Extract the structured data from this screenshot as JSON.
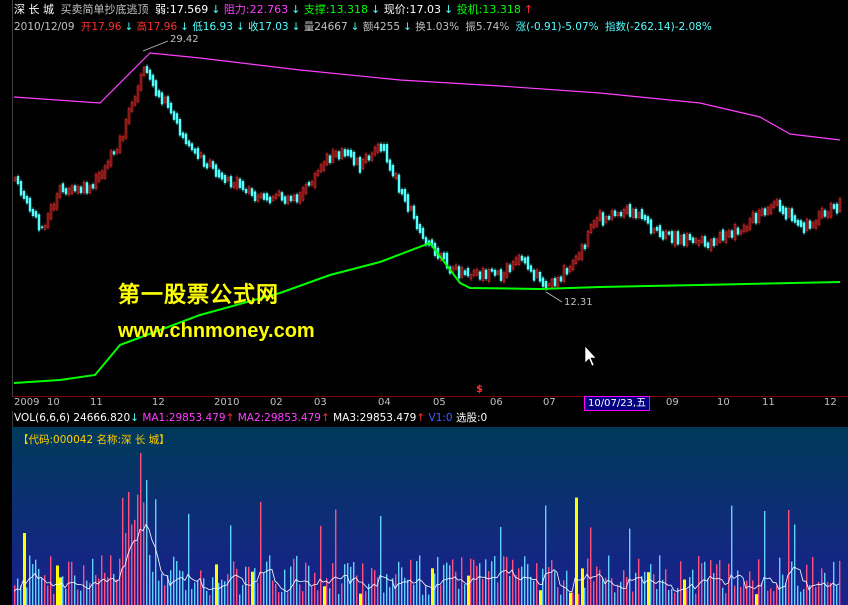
{
  "header": {
    "stock": "深 长 城",
    "formula": "买卖简单抄底逃顶",
    "weak": "弱:17.569",
    "resist": "阻力:22.763",
    "support": "支撑:13.318",
    "price": "现价:17.03",
    "invest": "投机:13.318"
  },
  "quote": {
    "date": "2010/12/09",
    "open": "开17.96",
    "high": "高17.96",
    "low": "低16.93",
    "close": "收17.03",
    "vol": "量24667",
    "amount": "额4255",
    "turnover": "换1.03%",
    "amplitude": "振5.74%",
    "change": "涨(-0.91)-5.07%",
    "index": "指数(-262.14)-2.08%"
  },
  "price_labels": {
    "high": "29.42",
    "low": "12.31"
  },
  "watermark": {
    "line1": "第一股票公式网",
    "line2": "www.chnmoney.com"
  },
  "axis_ticks": [
    "2009",
    "10",
    "11",
    "12",
    "2010",
    "02",
    "03",
    "04",
    "05",
    "06",
    "07",
    "09",
    "10",
    "11",
    "12"
  ],
  "axis_marker": "$",
  "date_cursor": "10/07/23,五",
  "volume": {
    "name": "VOL(6,6,6)",
    "vol": "24666.820",
    "ma1": "MA1:29853.479",
    "ma2": "MA2:29853.479",
    "ma3": "MA3:29853.479",
    "v1": "V1:0",
    "pick": "选股:0"
  },
  "code_bar": "【代码:000042 名称:深 长 城】",
  "colors": {
    "up": "#ff3030",
    "down": "#54ffff",
    "ma_green": "#00ff00",
    "ma_purple": "#ff40ff",
    "yellow": "#ffff00"
  }
}
